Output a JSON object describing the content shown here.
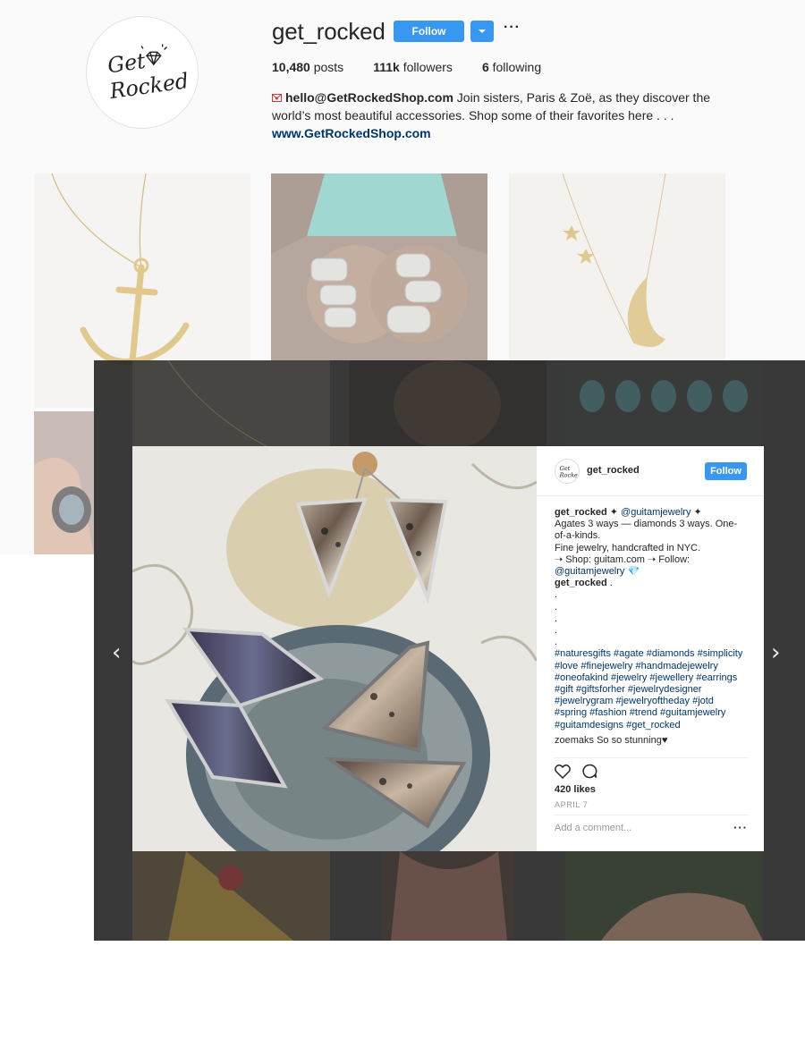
{
  "profile": {
    "username": "get_rocked",
    "follow_label": "Follow",
    "more_label": "···",
    "stats": {
      "posts_count": "10,480",
      "posts_label": "posts",
      "followers_count": "111k",
      "followers_label": "followers",
      "following_count": "6",
      "following_label": "following"
    },
    "bio": {
      "email": "hello@GetRockedShop.com",
      "text": " Join sisters, Paris & Zoë, as they discover the world’s most beautiful accessories. Shop some of their favorites here . . .",
      "website": "www.GetRockedShop.com"
    },
    "logo_text": [
      "Get",
      "Rocked"
    ]
  },
  "modal": {
    "username": "get_rocked",
    "follow_label": "Follow",
    "caption": {
      "author": "get_rocked",
      "line1_mid": " ✦ ",
      "mention1": "@guitamjewelry",
      "line1_end": " ✦",
      "line2": "Agates 3 ways — diamonds 3 ways. One-of-a-kinds.",
      "line3": "Fine jewelry, handcrafted in NYC.",
      "line4": "➝ Shop: guitam.com ➝ Follow:",
      "mention2": "@guitamjewelry",
      "gem": "💎",
      "author2": "get_rocked",
      "author2_end": " .",
      "dots": [
        ".",
        ".",
        ".",
        ".",
        "."
      ],
      "hashtags": "#naturesgifts #agate #diamonds #simplicity #love #finejewelry #handmadejewelry #oneofakind #jewelry #jewellery #earrings #gift #giftsforher #jewelrydesigner #jewelrygram #jewelryoftheday #jotd #spring #fashion #trend #guitamjewelry #guitamdesigns #get_rocked",
      "comment_peek": "zoemaks So so stunning♥"
    },
    "likes": "420 likes",
    "date": "APRIL 7",
    "comment_placeholder": "Add a comment...",
    "comment_more": "···",
    "nav_prev": "‹",
    "nav_next": "›"
  },
  "colors": {
    "accent": "#3897f0",
    "link": "#003569",
    "overlay": "#282828"
  }
}
